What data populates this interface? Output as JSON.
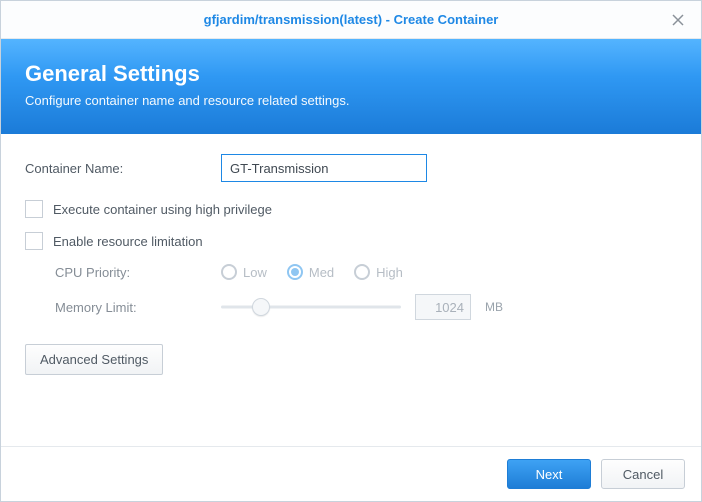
{
  "titlebar": {
    "title": "gfjardim/transmission(latest) - Create Container"
  },
  "banner": {
    "heading": "General Settings",
    "subtitle": "Configure container name and resource related settings."
  },
  "form": {
    "container_name_label": "Container Name:",
    "container_name_value": "GT-Transmission",
    "exec_high_priv_label": "Execute container using high privilege",
    "enable_resource_limit_label": "Enable resource limitation",
    "cpu_priority_label": "CPU Priority:",
    "cpu_options": {
      "low": "Low",
      "med": "Med",
      "high": "High"
    },
    "memory_limit_label": "Memory Limit:",
    "memory_limit_value": "1024",
    "memory_unit": "MB",
    "advanced_settings": "Advanced Settings"
  },
  "footer": {
    "next": "Next",
    "cancel": "Cancel"
  }
}
